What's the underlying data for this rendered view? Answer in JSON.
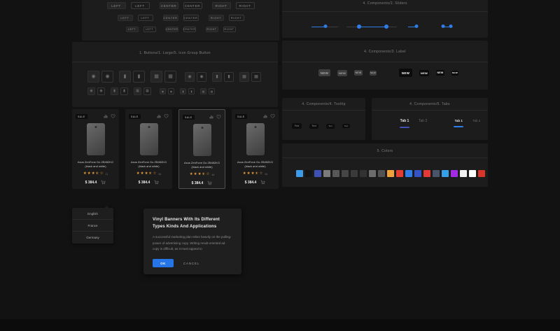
{
  "glyphs": {
    "camera": "◉",
    "bookmark": "▮",
    "image": "▦",
    "star_full": "★",
    "star_empty": "☆"
  },
  "buttons_panel": {
    "labels": [
      "LEFT",
      "LEFT",
      "CENTER",
      "CENTER",
      "RIGHT",
      "RIGHT"
    ]
  },
  "icon_panel": {
    "title": "1. Buttons/1. Large/5. Icon Group Button",
    "icon_names": [
      "camera",
      "bookmark",
      "image"
    ]
  },
  "sliders_panel": {
    "title": "4. Components/2. Sliders",
    "sliders": [
      {
        "type": "single",
        "value_pct": 53
      },
      {
        "type": "range",
        "from_pct": 25,
        "to_pct": 79
      },
      {
        "type": "single",
        "value_pct": 88
      },
      {
        "type": "range",
        "from_pct": 14,
        "to_pct": 82
      }
    ]
  },
  "label_panel": {
    "title": "4. Components/3. Label",
    "text": "NEW"
  },
  "tooltip_panel": {
    "title": "4. Components/4. Tooltip",
    "text": "Text"
  },
  "tabs_panel": {
    "title": "4. Components/5. Tabs",
    "groups": [
      {
        "tabs": [
          "Tab 1",
          "Tab 2"
        ],
        "active_index": 0
      },
      {
        "tabs": [
          "Tab 1",
          "Tab 2"
        ],
        "active_index": 0
      }
    ]
  },
  "colors_panel": {
    "title": "5. Colors",
    "swatches": [
      "#3d9ae8",
      "#141414",
      "#3f51b5",
      "#7b7b7b",
      "#575757",
      "#454545",
      "#3a3a3a",
      "#323232",
      "#6d6d6d",
      "#525252",
      "#efa23b",
      "#e23d32",
      "#2e7de9",
      "#3453c4",
      "#e53935",
      "#49566a",
      "#36a0e8",
      "#a32ce2",
      "#f1f1f1",
      "#ffffff",
      "#d8352b"
    ]
  },
  "product_cards": [
    {
      "badge": "SALE",
      "title": "Asus ZenFone Go ZB452KG (black and white)",
      "rating": 3.5,
      "review_count": "11",
      "price": "$ 384.4"
    },
    {
      "badge": "SALE",
      "title": "Asus ZenFone Go ZB452KG (black and white)",
      "rating": 3.5,
      "review_count": "46",
      "price": "$ 384.4"
    },
    {
      "badge": "SALE",
      "title": "Asus ZenFone Go ZB452KG (black and white)",
      "rating": 3.5,
      "review_count": "46",
      "price": "$ 384.4"
    },
    {
      "badge": "SALE",
      "title": "Asus ZenFone Go ZB452KG (black and white)",
      "rating": 3.5,
      "review_count": "46",
      "price": "$ 384.4"
    }
  ],
  "dropdown": {
    "items": [
      "English",
      "France",
      "Germany"
    ]
  },
  "modal": {
    "title": "Vinyl Banners With Its Different Types Kinds And Applications",
    "body": "A successful marketing plan relies heavily on the pulling-power of advertising copy. Writing result-oriented ad copy is difficult, as it must appeal to",
    "ok_label": "OK",
    "cancel_label": "CANCEL"
  }
}
